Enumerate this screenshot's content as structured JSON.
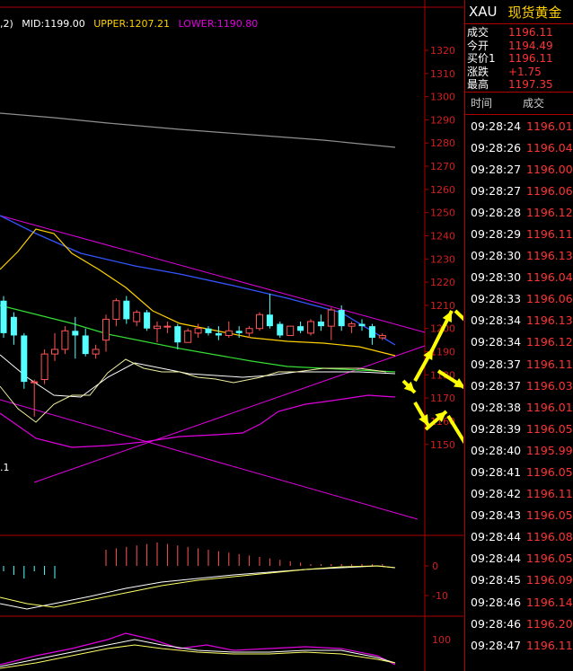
{
  "legend": {
    "prefix": ",2)",
    "mid": "MID:1199.00",
    "upper": "UPPER:1207.21",
    "lower": "LOWER:1190.80",
    "colors": {
      "mid": "#ffffff",
      "upper": "#ffd000",
      "lower": "#e000e0"
    }
  },
  "price_axis": {
    "labels": [
      "1320",
      "1310",
      "1300",
      "1290",
      "1280",
      "1270",
      "1260",
      "1250",
      "1240",
      "1230",
      "1220",
      "1210",
      "1200",
      "1190",
      "1180",
      "1170",
      "1160",
      "1150"
    ],
    "low_marker": ".1"
  },
  "macd_axis": {
    "labels": [
      "0",
      "-10"
    ]
  },
  "kdj_axis": {
    "labels": [
      "100"
    ]
  },
  "quote": {
    "code": "XAU",
    "name": "现货黄金",
    "rows": [
      {
        "label": "成交",
        "value": "1196.11"
      },
      {
        "label": "今开",
        "value": "1194.49"
      },
      {
        "label": "买价1",
        "value": "1196.11"
      },
      {
        "label": "涨跌",
        "value": "+1.75"
      },
      {
        "label": "最高",
        "value": "1197.35"
      }
    ]
  },
  "ticks": {
    "headers": [
      "时间",
      "成交"
    ],
    "rows": [
      {
        "time": "09:28:24",
        "price": "1196.01"
      },
      {
        "time": "09:28:26",
        "price": "1196.04"
      },
      {
        "time": "09:28:27",
        "price": "1196.00"
      },
      {
        "time": "09:28:27",
        "price": "1196.06"
      },
      {
        "time": "09:28:28",
        "price": "1196.12"
      },
      {
        "time": "09:28:29",
        "price": "1196.11"
      },
      {
        "time": "09:28:30",
        "price": "1196.13"
      },
      {
        "time": "09:28:30",
        "price": "1196.04"
      },
      {
        "time": "09:28:33",
        "price": "1196.06"
      },
      {
        "time": "09:28:34",
        "price": "1196.13"
      },
      {
        "time": "09:28:34",
        "price": "1196.12"
      },
      {
        "time": "09:28:37",
        "price": "1196.11"
      },
      {
        "time": "09:28:37",
        "price": "1196.03"
      },
      {
        "time": "09:28:38",
        "price": "1196.01"
      },
      {
        "time": "09:28:39",
        "price": "1196.05"
      },
      {
        "time": "09:28:40",
        "price": "1195.99"
      },
      {
        "time": "09:28:41",
        "price": "1196.05"
      },
      {
        "time": "09:28:42",
        "price": "1196.11"
      },
      {
        "time": "09:28:43",
        "price": "1196.05"
      },
      {
        "time": "09:28:44",
        "price": "1196.08"
      },
      {
        "time": "09:28:44",
        "price": "1196.05"
      },
      {
        "time": "09:28:45",
        "price": "1196.09"
      },
      {
        "time": "09:28:46",
        "price": "1196.14"
      },
      {
        "time": "09:28:46",
        "price": "1196.20"
      },
      {
        "time": "09:28:47",
        "price": "1196.11"
      }
    ]
  },
  "colors": {
    "background": "#000000",
    "grid": "#b00000",
    "up_candle": "#ff5555",
    "down_candle": "#55ffff",
    "arrow": "#ffff00"
  },
  "candles": [
    {
      "o": 1212,
      "h": 1214,
      "l": 1196,
      "c": 1198
    },
    {
      "o": 1205,
      "h": 1207,
      "l": 1193,
      "c": 1197
    },
    {
      "o": 1197,
      "h": 1198,
      "l": 1174,
      "c": 1177
    },
    {
      "o": 1177,
      "h": 1178,
      "l": 1162,
      "c": 1177
    },
    {
      "o": 1178,
      "h": 1191,
      "l": 1176,
      "c": 1189
    },
    {
      "o": 1189,
      "h": 1198,
      "l": 1186,
      "c": 1191
    },
    {
      "o": 1191,
      "h": 1201,
      "l": 1189,
      "c": 1199
    },
    {
      "o": 1199,
      "h": 1205,
      "l": 1187,
      "c": 1197
    },
    {
      "o": 1197,
      "h": 1200,
      "l": 1188,
      "c": 1189
    },
    {
      "o": 1189,
      "h": 1193,
      "l": 1187,
      "c": 1191
    },
    {
      "o": 1195,
      "h": 1206,
      "l": 1190,
      "c": 1204
    },
    {
      "o": 1204,
      "h": 1213,
      "l": 1201,
      "c": 1212
    },
    {
      "o": 1212,
      "h": 1214,
      "l": 1202,
      "c": 1204
    },
    {
      "o": 1203,
      "h": 1208,
      "l": 1201,
      "c": 1207
    },
    {
      "o": 1207,
      "h": 1208,
      "l": 1199,
      "c": 1200
    },
    {
      "o": 1200,
      "h": 1203,
      "l": 1194,
      "c": 1201
    },
    {
      "o": 1201,
      "h": 1203,
      "l": 1198,
      "c": 1201
    },
    {
      "o": 1201,
      "h": 1202,
      "l": 1191,
      "c": 1194
    },
    {
      "o": 1194,
      "h": 1200,
      "l": 1194,
      "c": 1199
    },
    {
      "o": 1198,
      "h": 1202,
      "l": 1196,
      "c": 1200
    },
    {
      "o": 1200,
      "h": 1201,
      "l": 1197,
      "c": 1198
    },
    {
      "o": 1198,
      "h": 1201,
      "l": 1195,
      "c": 1197
    },
    {
      "o": 1197,
      "h": 1203,
      "l": 1196,
      "c": 1199
    },
    {
      "o": 1199,
      "h": 1201,
      "l": 1196,
      "c": 1198
    },
    {
      "o": 1198,
      "h": 1201,
      "l": 1196,
      "c": 1200
    },
    {
      "o": 1200,
      "h": 1207,
      "l": 1199,
      "c": 1206
    },
    {
      "o": 1206,
      "h": 1215,
      "l": 1200,
      "c": 1201
    },
    {
      "o": 1202,
      "h": 1203,
      "l": 1196,
      "c": 1197
    },
    {
      "o": 1197,
      "h": 1201,
      "l": 1197,
      "c": 1201
    },
    {
      "o": 1201,
      "h": 1203,
      "l": 1198,
      "c": 1199
    },
    {
      "o": 1198,
      "h": 1204,
      "l": 1197,
      "c": 1203
    },
    {
      "o": 1203,
      "h": 1206,
      "l": 1199,
      "c": 1201
    },
    {
      "o": 1201,
      "h": 1209,
      "l": 1195,
      "c": 1208
    },
    {
      "o": 1208,
      "h": 1210,
      "l": 1199,
      "c": 1201
    },
    {
      "o": 1201,
      "h": 1203,
      "l": 1198,
      "c": 1202
    },
    {
      "o": 1202,
      "h": 1204,
      "l": 1199,
      "c": 1201
    },
    {
      "o": 1201,
      "h": 1202,
      "l": 1193,
      "c": 1196
    },
    {
      "o": 1196,
      "h": 1198,
      "l": 1195,
      "c": 1197
    }
  ]
}
